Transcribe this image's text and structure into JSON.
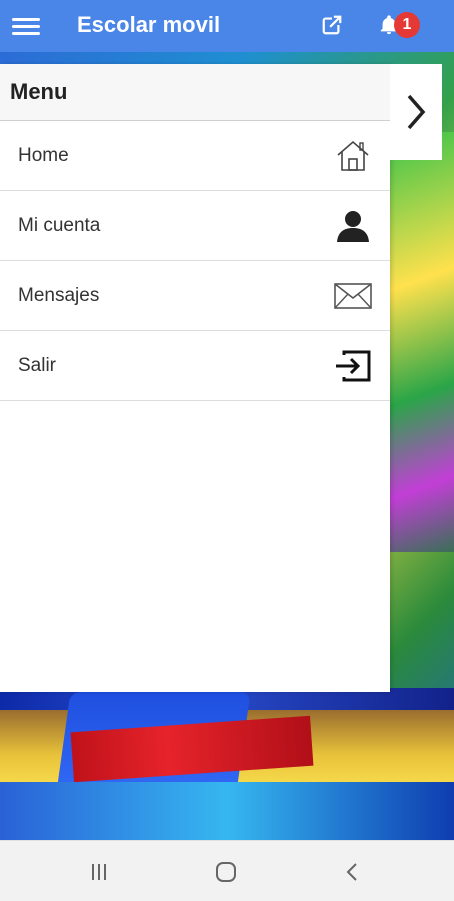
{
  "appbar": {
    "title": "Escolar movil",
    "notification_count": "1",
    "icons": {
      "menu": "hamburger-menu-icon",
      "open": "open-external-icon",
      "notifications": "bell-icon"
    },
    "color": "#4a86e8"
  },
  "menu": {
    "header": "Menu",
    "items": [
      {
        "label": "Home",
        "icon": "home-icon"
      },
      {
        "label": "Mi cuenta",
        "icon": "user-icon"
      },
      {
        "label": "Mensajes",
        "icon": "mail-icon"
      },
      {
        "label": "Salir",
        "icon": "logout-icon"
      }
    ]
  },
  "drawer_toggle_icon": "chevron-right-icon",
  "navbar": {
    "buttons": [
      "recent-apps-icon",
      "home-circle-icon",
      "back-icon"
    ]
  },
  "colors": {
    "badge": "#e53935",
    "appbar": "#4a86e8"
  }
}
